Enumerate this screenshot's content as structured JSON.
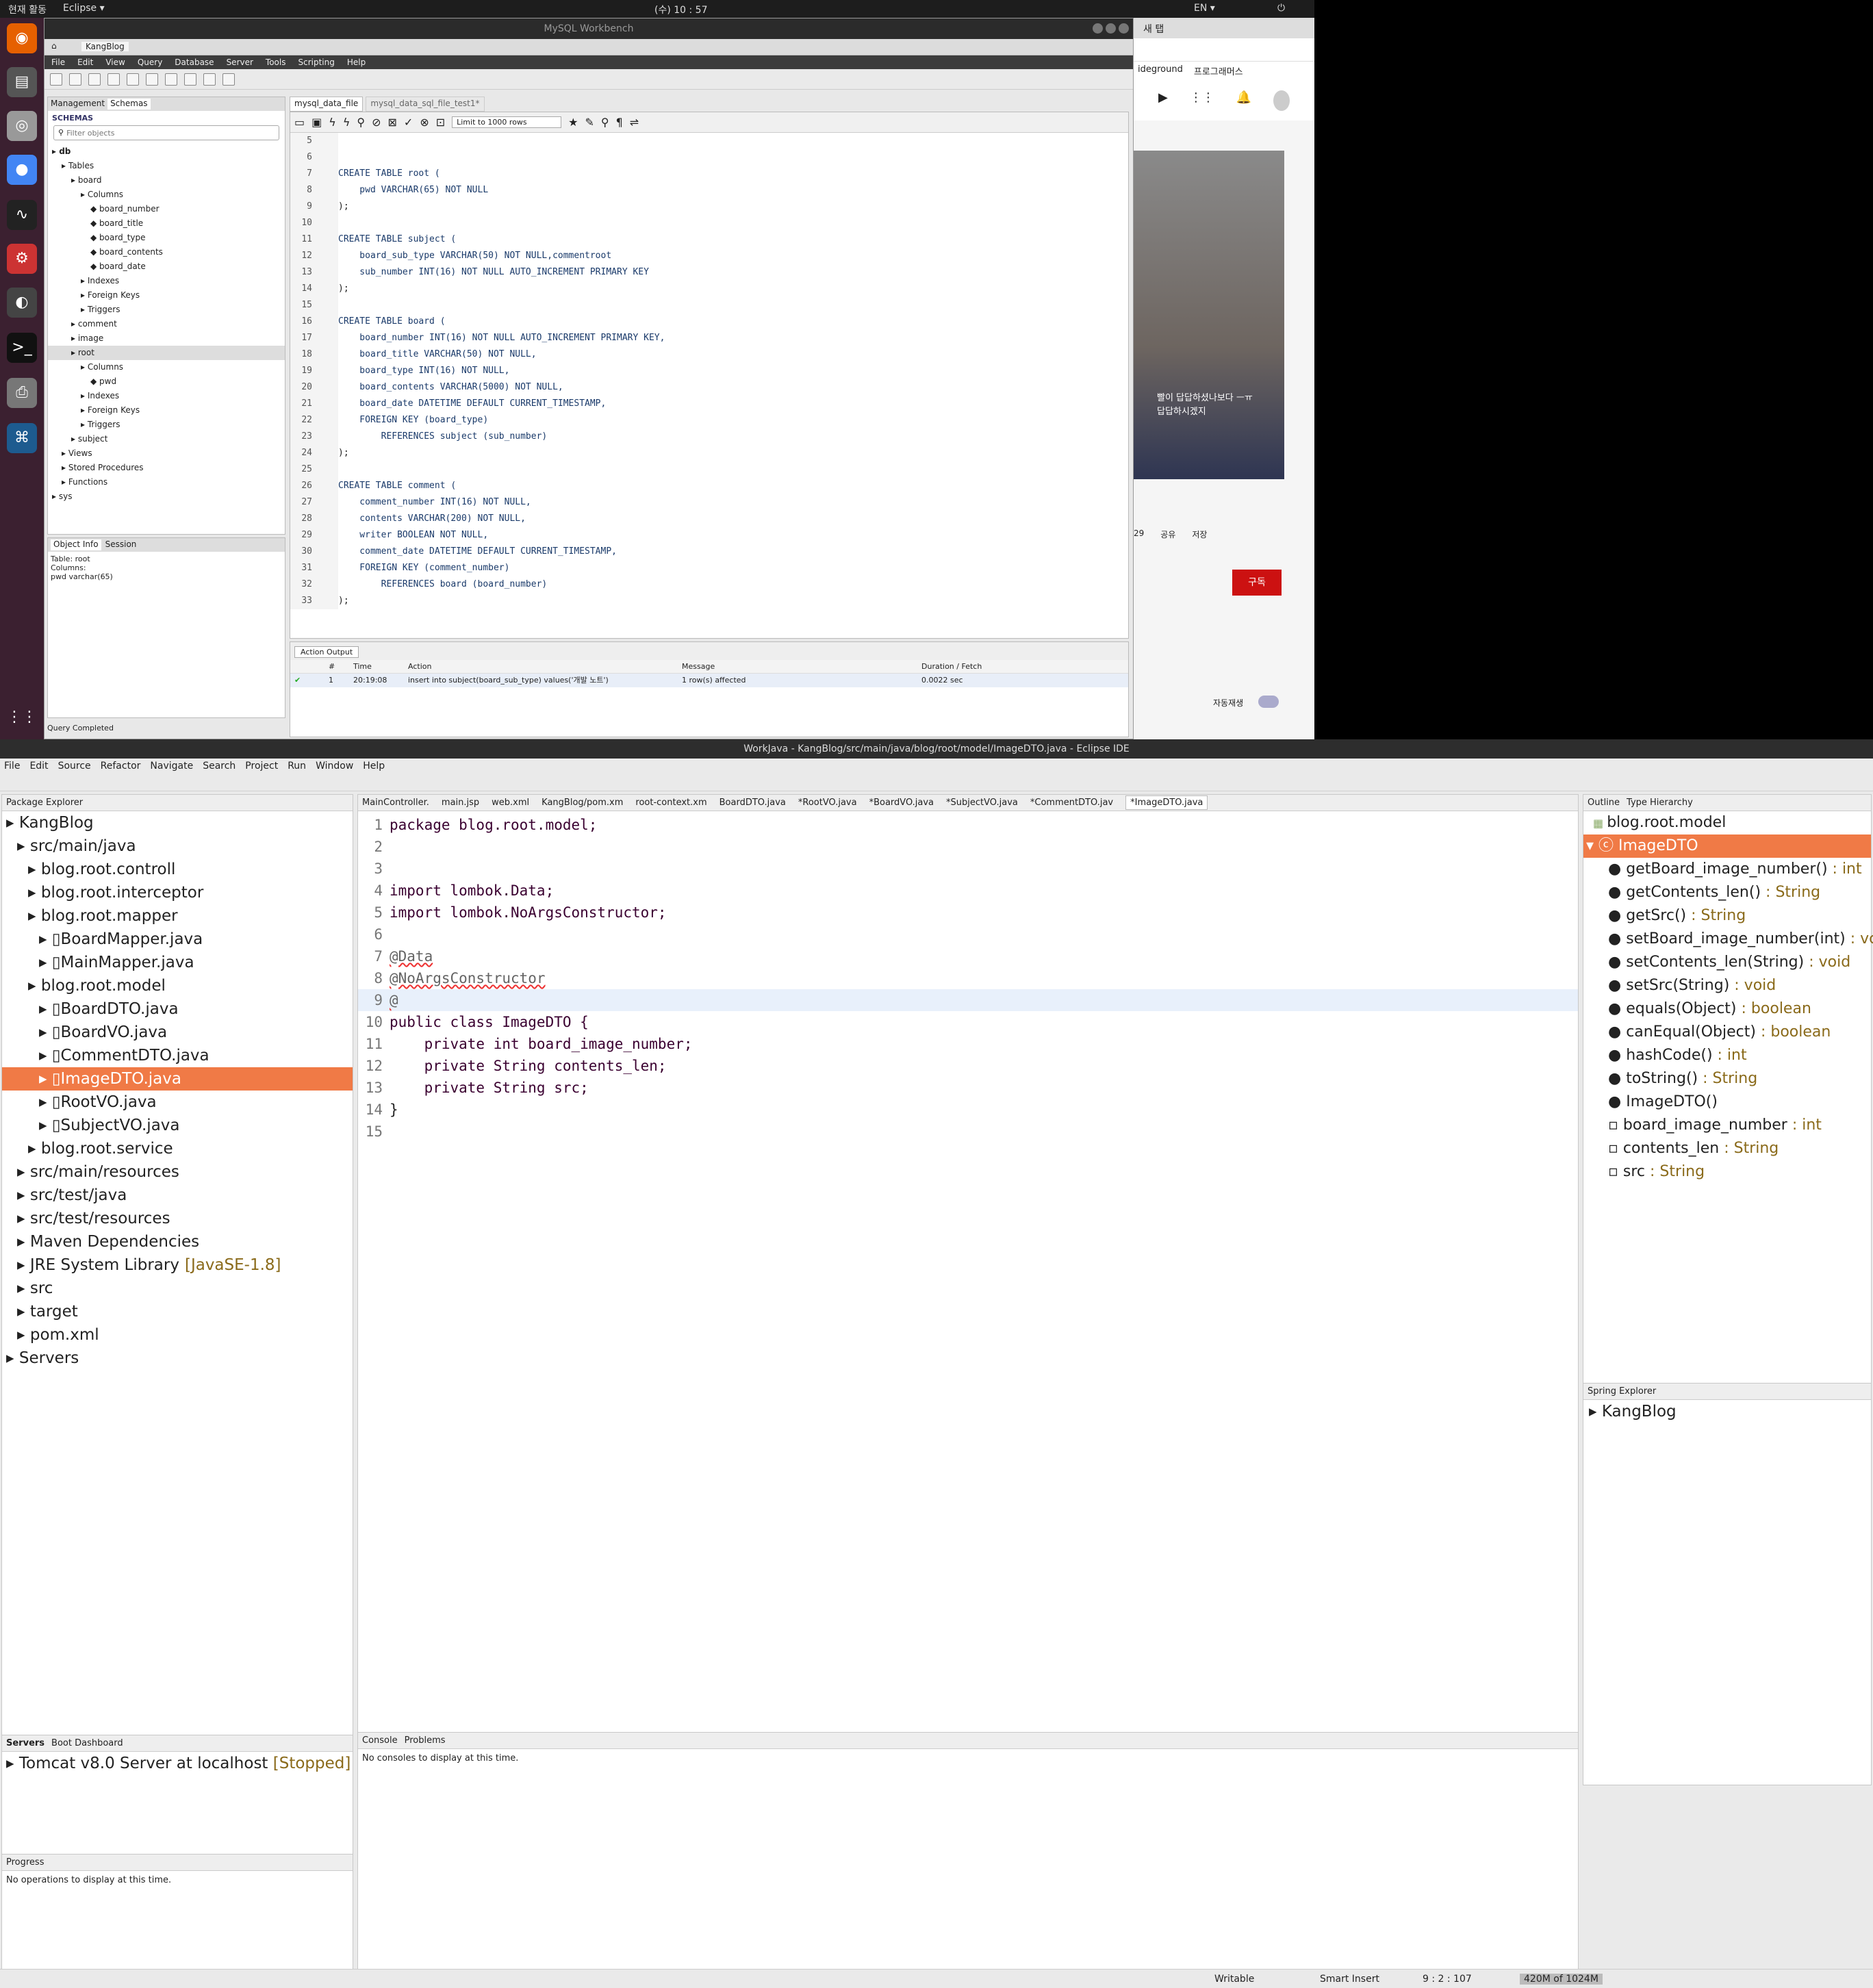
{
  "os": {
    "activities": "현재 활동",
    "app_menu": "Eclipse ▾",
    "clock": "(수) 10 : 57",
    "lang": "EN ▾"
  },
  "workbench": {
    "title": "MySQL Workbench",
    "conn_tab": "KangBlog",
    "menu": [
      "File",
      "Edit",
      "View",
      "Query",
      "Database",
      "Server",
      "Tools",
      "Scripting",
      "Help"
    ],
    "sidebar_tabs": [
      "Management",
      "Schemas"
    ],
    "schemas_label": "SCHEMAS",
    "filter_placeholder": "Filter objects",
    "tree": [
      {
        "t": "db",
        "i": 0,
        "bold": true
      },
      {
        "t": "Tables",
        "i": 1
      },
      {
        "t": "board",
        "i": 2
      },
      {
        "t": "Columns",
        "i": 3
      },
      {
        "t": "board_number",
        "i": 4
      },
      {
        "t": "board_title",
        "i": 4
      },
      {
        "t": "board_type",
        "i": 4
      },
      {
        "t": "board_contents",
        "i": 4
      },
      {
        "t": "board_date",
        "i": 4
      },
      {
        "t": "Indexes",
        "i": 3
      },
      {
        "t": "Foreign Keys",
        "i": 3
      },
      {
        "t": "Triggers",
        "i": 3
      },
      {
        "t": "comment",
        "i": 2
      },
      {
        "t": "image",
        "i": 2
      },
      {
        "t": "root",
        "i": 2,
        "sel": true
      },
      {
        "t": "Columns",
        "i": 3
      },
      {
        "t": "pwd",
        "i": 4
      },
      {
        "t": "Indexes",
        "i": 3
      },
      {
        "t": "Foreign Keys",
        "i": 3
      },
      {
        "t": "Triggers",
        "i": 3
      },
      {
        "t": "subject",
        "i": 2
      },
      {
        "t": "Views",
        "i": 1
      },
      {
        "t": "Stored Procedures",
        "i": 1
      },
      {
        "t": "Functions",
        "i": 1
      },
      {
        "t": "sys",
        "i": 0
      }
    ],
    "info_tabs": [
      "Object Info",
      "Session"
    ],
    "info_lines": [
      "Table: root",
      "Columns:",
      "pwd     varchar(65)"
    ],
    "editor_tabs": [
      "mysql_data_file",
      "mysql_data_sql_file_test1*"
    ],
    "limit": "Limit to 1000 rows",
    "sql_lines": [
      {
        "n": "5",
        "c": ""
      },
      {
        "n": "6",
        "c": ""
      },
      {
        "n": "7",
        "c": "CREATE TABLE root ("
      },
      {
        "n": "8",
        "c": "    pwd VARCHAR(65) NOT NULL"
      },
      {
        "n": "9",
        "c": ");"
      },
      {
        "n": "10",
        "c": ""
      },
      {
        "n": "11",
        "c": "CREATE TABLE subject ("
      },
      {
        "n": "12",
        "c": "    board_sub_type VARCHAR(50) NOT NULL,commentroot"
      },
      {
        "n": "13",
        "c": "    sub_number INT(16) NOT NULL AUTO_INCREMENT PRIMARY KEY"
      },
      {
        "n": "14",
        "c": ");"
      },
      {
        "n": "15",
        "c": ""
      },
      {
        "n": "16",
        "c": "CREATE TABLE board ("
      },
      {
        "n": "17",
        "c": "    board_number INT(16) NOT NULL AUTO_INCREMENT PRIMARY KEY,"
      },
      {
        "n": "18",
        "c": "    board_title VARCHAR(50) NOT NULL,"
      },
      {
        "n": "19",
        "c": "    board_type INT(16) NOT NULL,"
      },
      {
        "n": "20",
        "c": "    board_contents VARCHAR(5000) NOT NULL,"
      },
      {
        "n": "21",
        "c": "    board_date DATETIME DEFAULT CURRENT_TIMESTAMP,"
      },
      {
        "n": "22",
        "c": "    FOREIGN KEY (board_type)"
      },
      {
        "n": "23",
        "c": "        REFERENCES subject (sub_number)"
      },
      {
        "n": "24",
        "c": ");"
      },
      {
        "n": "25",
        "c": ""
      },
      {
        "n": "26",
        "c": "CREATE TABLE comment ("
      },
      {
        "n": "27",
        "c": "    comment_number INT(16) NOT NULL,"
      },
      {
        "n": "28",
        "c": "    contents VARCHAR(200) NOT NULL,"
      },
      {
        "n": "29",
        "c": "    writer BOOLEAN NOT NULL,"
      },
      {
        "n": "30",
        "c": "    comment_date DATETIME DEFAULT CURRENT_TIMESTAMP,"
      },
      {
        "n": "31",
        "c": "    FOREIGN KEY (comment_number)"
      },
      {
        "n": "32",
        "c": "        REFERENCES board (board_number)"
      },
      {
        "n": "33",
        "c": ");"
      }
    ],
    "output_select": "Action Output",
    "output_headers": [
      "#",
      "Time",
      "Action",
      "Message",
      "Duration / Fetch"
    ],
    "output_row": [
      "1",
      "20:19:08",
      "insert into subject(board_sub_type) values('개발 노트')",
      "1 row(s) affected",
      "0.0022 sec"
    ],
    "status": "Query Completed"
  },
  "browser": {
    "tab": "새 탭",
    "bookmarks": [
      "ideground",
      "프로그래머스"
    ],
    "overlay1": "빨이 답답하셨나보다 ㅡㅠ",
    "overlay2": "답답하시겠지",
    "actions": [
      "29",
      "공유",
      "저장"
    ],
    "subscribe": "구독",
    "autoplay": "자동재생"
  },
  "eclipse": {
    "title": "WorkJava - KangBlog/src/main/java/blog/root/model/ImageDTO.java - Eclipse IDE",
    "menu": [
      "File",
      "Edit",
      "Source",
      "Refactor",
      "Navigate",
      "Search",
      "Project",
      "Run",
      "Window",
      "Help"
    ],
    "pkg_title": "Package Explorer",
    "pkg_tree": [
      {
        "t": "KangBlog",
        "i": 0
      },
      {
        "t": "src/main/java",
        "i": 1
      },
      {
        "t": "blog.root.controll",
        "i": 2
      },
      {
        "t": "blog.root.interceptor",
        "i": 2
      },
      {
        "t": "blog.root.mapper",
        "i": 2
      },
      {
        "t": "BoardMapper.java",
        "i": 3
      },
      {
        "t": "MainMapper.java",
        "i": 3
      },
      {
        "t": "blog.root.model",
        "i": 2
      },
      {
        "t": "BoardDTO.java",
        "i": 3
      },
      {
        "t": "BoardVO.java",
        "i": 3
      },
      {
        "t": "CommentDTO.java",
        "i": 3
      },
      {
        "t": "ImageDTO.java",
        "i": 3,
        "sel": true
      },
      {
        "t": "RootVO.java",
        "i": 3
      },
      {
        "t": "SubjectVO.java",
        "i": 3
      },
      {
        "t": "blog.root.service",
        "i": 2
      },
      {
        "t": "src/main/resources",
        "i": 1
      },
      {
        "t": "src/test/java",
        "i": 1
      },
      {
        "t": "src/test/resources",
        "i": 1
      },
      {
        "t": "Maven Dependencies",
        "i": 1
      },
      {
        "t": "JRE System Library",
        "i": 1,
        "x": "[JavaSE-1.8]"
      },
      {
        "t": "src",
        "i": 1
      },
      {
        "t": "target",
        "i": 1
      },
      {
        "t": "pom.xml",
        "i": 1
      },
      {
        "t": "Servers",
        "i": 0
      }
    ],
    "editor_tabs": [
      "MainController.",
      "main.jsp",
      "web.xml",
      "KangBlog/pom.xm",
      "root-context.xm",
      "BoardDTO.java",
      "*RootVO.java",
      "*BoardVO.java",
      "*SubjectVO.java",
      "*CommentDTO.jav",
      "*ImageDTO.java"
    ],
    "code": [
      {
        "n": "1",
        "c": "package blog.root.model;"
      },
      {
        "n": "2",
        "c": ""
      },
      {
        "n": "3",
        "c": ""
      },
      {
        "n": "4",
        "c": "import lombok.Data;"
      },
      {
        "n": "5",
        "c": "import lombok.NoArgsConstructor;"
      },
      {
        "n": "6",
        "c": ""
      },
      {
        "n": "7",
        "c": "@Data"
      },
      {
        "n": "8",
        "c": "@NoArgsConstructor"
      },
      {
        "n": "9",
        "c": "@"
      },
      {
        "n": "10",
        "c": "public class ImageDTO {"
      },
      {
        "n": "11",
        "c": "    private int board_image_number;"
      },
      {
        "n": "12",
        "c": "    private String contents_len;"
      },
      {
        "n": "13",
        "c": "    private String src;"
      },
      {
        "n": "14",
        "c": "}"
      },
      {
        "n": "15",
        "c": ""
      }
    ],
    "outline_tabs": [
      "Outline",
      "Type Hierarchy"
    ],
    "outline_pkg": "blog.root.model",
    "outline_class": "ImageDTO",
    "outline": [
      {
        "m": "getBoard_image_number()",
        "r": " : int"
      },
      {
        "m": "getContents_len()",
        "r": " : String"
      },
      {
        "m": "getSrc()",
        "r": " : String"
      },
      {
        "m": "setBoard_image_number(int)",
        "r": " : vc"
      },
      {
        "m": "setContents_len(String)",
        "r": " : void"
      },
      {
        "m": "setSrc(String)",
        "r": " : void"
      },
      {
        "m": "equals(Object)",
        "r": " : boolean"
      },
      {
        "m": "canEqual(Object)",
        "r": " : boolean"
      },
      {
        "m": "hashCode()",
        "r": " : int"
      },
      {
        "m": "toString()",
        "r": " : String"
      },
      {
        "m": "ImageDTO()",
        "r": ""
      },
      {
        "m": "board_image_number",
        "r": " : int"
      },
      {
        "m": "contents_len",
        "r": " : String"
      },
      {
        "m": "src",
        "r": " : String"
      }
    ],
    "spring_title": "Spring Explorer",
    "spring_item": "KangBlog",
    "servers_tabs": [
      "Servers",
      "Boot Dashboard"
    ],
    "server_item": "Tomcat v8.0 Server at localhost",
    "server_state": "[Stopped]",
    "progress_title": "Progress",
    "progress_text": "No operations to display at this time.",
    "console_tabs": [
      "Console",
      "Problems"
    ],
    "console_text": "No consoles to display at this time.",
    "status_writable": "Writable",
    "status_insert": "Smart Insert",
    "status_pos": "9 : 2 : 107",
    "status_mem": "420M of 1024M"
  }
}
